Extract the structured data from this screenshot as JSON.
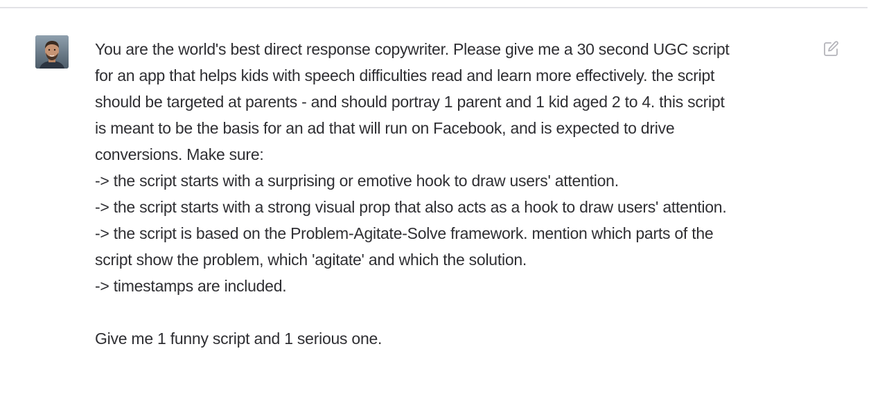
{
  "message": {
    "author_avatar_icon": "user-avatar-photo",
    "lines": [
      "You are the world's best direct response copywriter. Please give me a 30 second UGC script",
      "for an app that helps kids with speech difficulties read and learn more effectively. the script",
      "should be targeted at parents - and should portray 1 parent and 1 kid aged 2 to 4. this script",
      "is meant to be the basis for an ad that will run on Facebook, and is expected to drive",
      "conversions. Make sure:",
      "-> the script starts with a surprising or emotive hook to draw users' attention.",
      "-> the script starts with a strong visual prop that also acts as a hook to draw users' attention.",
      "-> the script is based on the Problem-Agitate-Solve framework. mention which parts of the",
      "script show the problem, which 'agitate' and which the solution.",
      "-> timestamps are included.",
      "",
      "Give me 1 funny script and 1 serious one."
    ],
    "edit_icon": "edit-icon"
  },
  "colors": {
    "text": "#2f2f33",
    "divider": "#e2e2e6",
    "icon": "#b4b4ba",
    "background": "#ffffff"
  }
}
